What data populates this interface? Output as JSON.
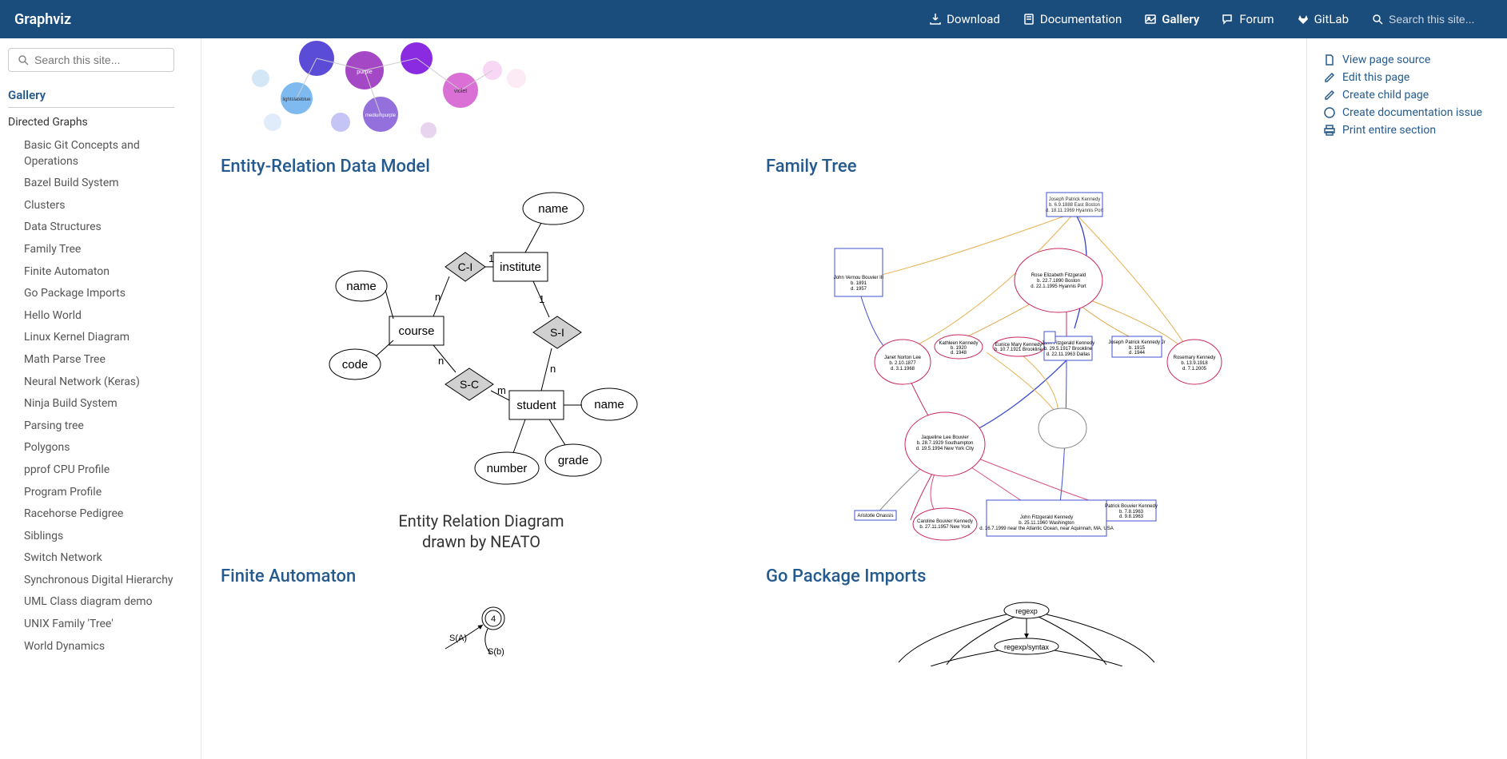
{
  "brand": "Graphviz",
  "nav": {
    "download": "Download",
    "documentation": "Documentation",
    "gallery": "Gallery",
    "forum": "Forum",
    "gitlab": "GitLab",
    "search_placeholder": "Search this site..."
  },
  "sidebar": {
    "search_placeholder": "Search this site...",
    "heading": "Gallery",
    "category": "Directed Graphs",
    "items": [
      "Basic Git Concepts and Operations",
      "Bazel Build System",
      "Clusters",
      "Data Structures",
      "Family Tree",
      "Finite Automaton",
      "Go Package Imports",
      "Hello World",
      "Linux Kernel Diagram",
      "Math Parse Tree",
      "Neural Network (Keras)",
      "Ninja Build System",
      "Parsing tree",
      "Polygons",
      "pprof CPU Profile",
      "Program Profile",
      "Racehorse Pedigree",
      "Siblings",
      "Switch Network",
      "Synchronous Digital Hierarchy",
      "UML Class diagram demo",
      "UNIX Family 'Tree'",
      "World Dynamics"
    ]
  },
  "gallery": {
    "entity_relation": {
      "title": "Entity-Relation Data Model",
      "caption1": "Entity Relation Diagram",
      "caption2": "drawn by NEATO",
      "nodes": {
        "name1": "name",
        "institute": "institute",
        "name2": "name",
        "course": "course",
        "ci": "C-I",
        "si": "S-I",
        "sc": "S-C",
        "code": "code",
        "student": "student",
        "name3": "name",
        "number": "number",
        "grade": "grade",
        "e1": "1",
        "en1": "n",
        "en2": "1",
        "en3": "n",
        "en4": "n",
        "em": "m"
      }
    },
    "family_tree": {
      "title": "Family Tree"
    },
    "finite_automaton": {
      "title": "Finite Automaton",
      "node4": "4",
      "sa": "S(A)",
      "sb": "S(b)"
    },
    "go_imports": {
      "title": "Go Package Imports",
      "n1": "regexp",
      "n2": "regexp/syntax"
    }
  },
  "rightbar": {
    "view_source": "View page source",
    "edit": "Edit this page",
    "create_child": "Create child page",
    "create_issue": "Create documentation issue",
    "print": "Print entire section"
  },
  "family_nodes": {
    "jpk": "Joseph Patrick Kennedy\nb. 6.9.1888 East Boston\nd. 18.11.1969 Hyannis Port",
    "ref": "Rose Elizabeth Fitzgerald\nb. 22.7.1890 Boston\nd. 22.1.1995 Hyannis Port",
    "jvb": "John Vernou Bouvier III\nb. 1891\nd. 1957",
    "jnl": "Janet Norton Lee\nb. 2.10.1877\nd. 3.1.1968",
    "kk": "Kathleen Kennedy\nb. 1920\nd. 1948",
    "emk": "Eunice Mary Kennedy\nb. 10.7.1921 Brookline",
    "jfk": "John Fitzgerald Kennedy\nb. 29.5.1917 Brookline\nd. 22.11.1963 Dallas",
    "jpk2": "Joseph Patrick Kennedy Jr\nb. 1915\nd. 1944",
    "rk": "Rosemary Kennedy\nb. 13.9.1918\nd. 7.1.2005",
    "jlb": "Jaqueline Lee Bouvier\nb. 28.7.1929 Southampton\nd. 19.5.1994 New York City",
    "ao": "Aristotle Onassis",
    "cbk": "Caroline Bouvier Kennedy\nb. 27.11.1957 New York",
    "jfk2": "John Fitzgerald Kennedy\nb. 25.11.1960 Washington\nd. 16.7.1999 near the Atlantic Ocean, near Aquinnah, MA, USA",
    "pbk": "Patrick Bouvier Kennedy\nb. 7.8.1963\nd. 9.8.1963"
  }
}
